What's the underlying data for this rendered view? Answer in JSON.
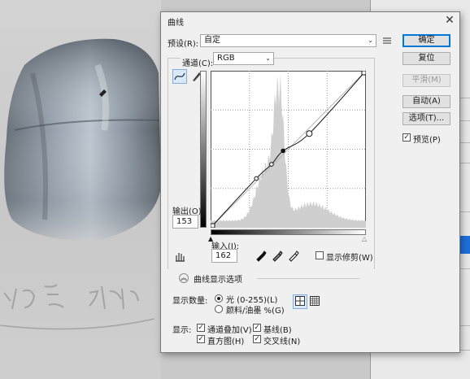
{
  "dialog": {
    "title": "曲线",
    "close_glyph": "✕",
    "preset_label": "预设(R):",
    "preset_value": "自定",
    "channel_label": "通道(C):",
    "channel_value": "RGB",
    "output_label": "输出(O):",
    "output_value": "153",
    "input_label": "输入(I):",
    "input_value": "162",
    "show_clipping_label": "显示修剪(W)",
    "curve_display_options_label": "曲线显示选项",
    "show_amount_label": "显示数量:",
    "light_label": "光 (0-255)(L)",
    "pigment_label": "颜料/油墨 %(G)",
    "show_label": "显示:",
    "channel_overlays_label": "通道叠加(V)",
    "baseline_label": "基线(B)",
    "histogram_label": "直方图(H)",
    "intersection_label": "交叉线(N)",
    "preview_label": "预览(P)"
  },
  "buttons": {
    "ok": "确定",
    "reset": "复位",
    "smooth": "平滑(M)",
    "auto": "自动(A)",
    "options": "选项(T)..."
  },
  "state": {
    "preview": true,
    "show_clipping": false,
    "light_selected": true,
    "channel_overlays": true,
    "baseline": true,
    "histogram": true,
    "intersection": true,
    "grid": "simple"
  },
  "curve": {
    "points": [
      [
        0,
        0
      ],
      [
        75,
        80
      ],
      [
        100,
        103
      ],
      [
        119,
        125
      ],
      [
        162,
        153
      ],
      [
        255,
        255
      ]
    ]
  },
  "icons": {
    "preset_menu": "preset-menu-icon",
    "curve_tool": "curve-edit-icon",
    "pencil_tool": "pencil-icon",
    "hand_tool": "on-image-adjust-icon",
    "black_eyedropper": "black-point-eyedropper-icon",
    "gray_eyedropper": "gray-point-eyedropper-icon",
    "white_eyedropper": "white-point-eyedropper-icon",
    "expand": "chevron-up-icon"
  }
}
